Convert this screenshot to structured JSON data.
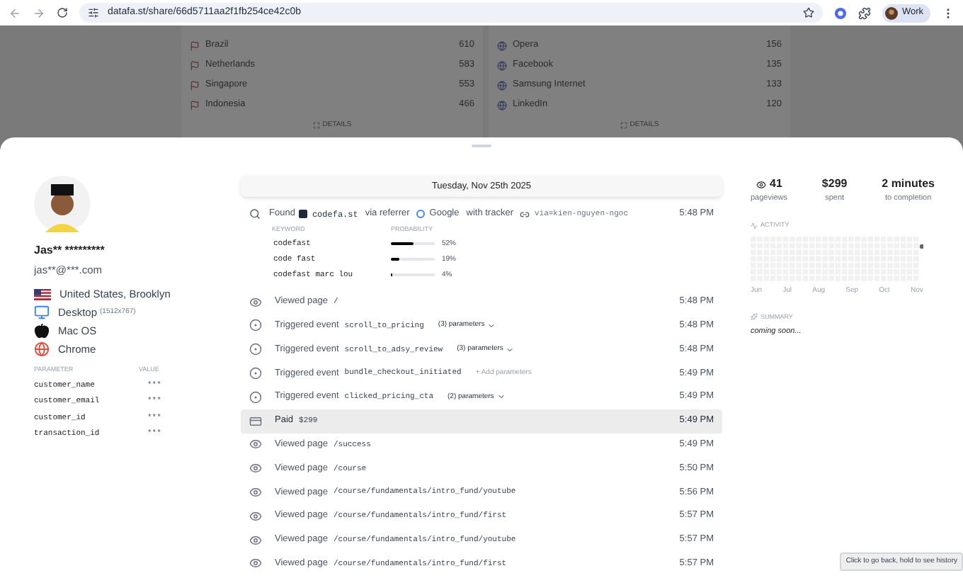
{
  "browser": {
    "url": "datafa.st/share/66d5711aa2f1fb254ce42c0b",
    "profile": "Work"
  },
  "background": {
    "cards": [
      {
        "rows": [
          {
            "name": "Brazil",
            "value": "610"
          },
          {
            "name": "Netherlands",
            "value": "583"
          },
          {
            "name": "Singapore",
            "value": "553"
          },
          {
            "name": "Indonesia",
            "value": "466"
          }
        ],
        "details": "DETAILS"
      },
      {
        "rows": [
          {
            "name": "Opera",
            "value": "156"
          },
          {
            "name": "Facebook",
            "value": "135"
          },
          {
            "name": "Samsung Internet",
            "value": "133"
          },
          {
            "name": "LinkedIn",
            "value": "120"
          }
        ],
        "details": "DETAILS"
      }
    ]
  },
  "visitor": {
    "name": "Jas** *********",
    "email": "jas**@***.com",
    "info": [
      {
        "kind": "location",
        "text": "United States, Brooklyn"
      },
      {
        "kind": "device",
        "text": "Desktop",
        "detail": "(1512x767)"
      },
      {
        "kind": "os",
        "text": "Mac OS"
      },
      {
        "kind": "browser",
        "text": "Chrome"
      }
    ],
    "parameters": {
      "columns": [
        "PARAMETER",
        "VALUE"
      ],
      "rows": [
        {
          "name": "customer_name",
          "value": "***"
        },
        {
          "name": "customer_email",
          "value": "***"
        },
        {
          "name": "customer_id",
          "value": "***"
        },
        {
          "name": "transaction_id",
          "value": "***"
        }
      ]
    }
  },
  "timeline": {
    "date": "Tuesday, Nov 25th 2025",
    "found": {
      "label": "Found",
      "source": "codefa.st",
      "via": "via referrer",
      "referrer": "Google",
      "with": "with tracker",
      "tracker": "via=kien-nguyen-ngoc",
      "time": "5:48 PM",
      "keywords": {
        "columns": [
          "KEYWORD",
          "PROBABILITY"
        ],
        "rows": [
          {
            "keyword": "codefast",
            "level": 0.52,
            "percent": "52%"
          },
          {
            "keyword": "code fast",
            "level": 0.19,
            "percent": "19%"
          },
          {
            "keyword": "codefast marc lou",
            "level": 0.04,
            "percent": "4%"
          }
        ]
      }
    },
    "events": [
      {
        "kind": "view",
        "label": "Viewed page",
        "value": "/",
        "time": "5:48 PM",
        "selected": false
      },
      {
        "kind": "event",
        "label": "Triggered event",
        "value": "scroll_to_pricing",
        "extra": {
          "kind": "params",
          "text": "(3) parameters"
        },
        "time": "5:48 PM",
        "selected": false
      },
      {
        "kind": "event",
        "label": "Triggered event",
        "value": "scroll_to_adsy_review",
        "extra": {
          "kind": "params",
          "text": "(3) parameters"
        },
        "time": "5:48 PM",
        "selected": false
      },
      {
        "kind": "event",
        "label": "Triggered event",
        "value": "bundle_checkout_initiated",
        "extra": {
          "kind": "add",
          "text": "+ Add parameters"
        },
        "time": "5:49 PM",
        "selected": false
      },
      {
        "kind": "event",
        "label": "Triggered event",
        "value": "clicked_pricing_cta",
        "extra": {
          "kind": "params",
          "text": "(2) parameters"
        },
        "time": "5:49 PM",
        "selected": false
      },
      {
        "kind": "paid",
        "label": "Paid",
        "value": "$299",
        "time": "5:49 PM",
        "selected": true
      },
      {
        "kind": "view",
        "label": "Viewed page",
        "value": "/success",
        "time": "5:49 PM",
        "selected": false
      },
      {
        "kind": "view",
        "label": "Viewed page",
        "value": "/course",
        "time": "5:50 PM",
        "selected": false
      },
      {
        "kind": "view",
        "label": "Viewed page",
        "value": "/course/fundamentals/intro_fund/youtube",
        "time": "5:56 PM",
        "selected": false
      },
      {
        "kind": "view",
        "label": "Viewed page",
        "value": "/course/fundamentals/intro_fund/first",
        "time": "5:57 PM",
        "selected": false
      },
      {
        "kind": "view",
        "label": "Viewed page",
        "value": "/course/fundamentals/intro_fund/youtube",
        "time": "5:57 PM",
        "selected": false
      },
      {
        "kind": "view",
        "label": "Viewed page",
        "value": "/course/fundamentals/intro_fund/first",
        "time": "5:57 PM",
        "selected": false
      }
    ]
  },
  "stats": [
    {
      "kind": "views",
      "value": "41",
      "label": "pageviews"
    },
    {
      "kind": "plain",
      "value": "$299",
      "label": "spent"
    },
    {
      "kind": "plain",
      "value": "2 minutes",
      "label": "to completion"
    }
  ],
  "activity": {
    "title": "ACTIVITY",
    "months": [
      "Jun",
      "Jul",
      "Aug",
      "Sep",
      "Oct",
      "Nov"
    ]
  },
  "summary": {
    "title": "SUMMARY",
    "text": "coming soon..."
  },
  "tooltip": "Click to go back, hold to see history"
}
